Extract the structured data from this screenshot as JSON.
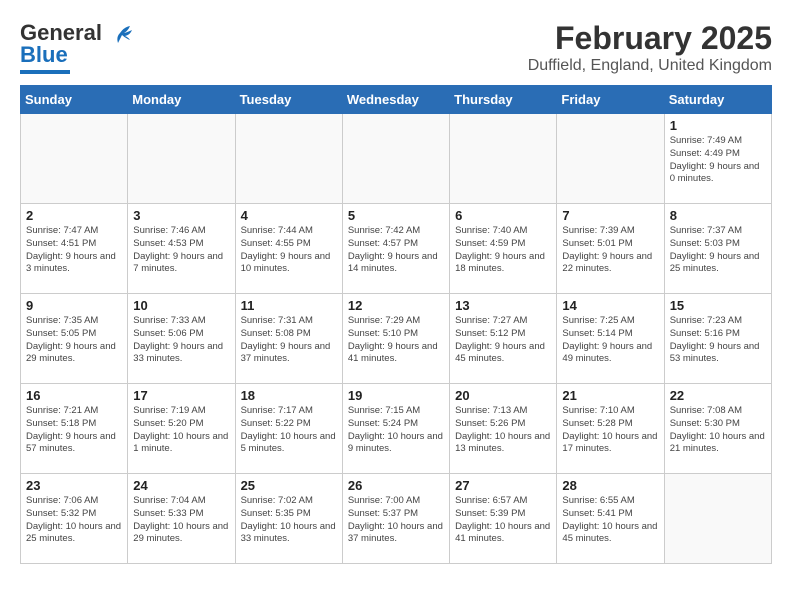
{
  "header": {
    "logo_general": "General",
    "logo_blue": "Blue",
    "title": "February 2025",
    "subtitle": "Duffield, England, United Kingdom"
  },
  "days_of_week": [
    "Sunday",
    "Monday",
    "Tuesday",
    "Wednesday",
    "Thursday",
    "Friday",
    "Saturday"
  ],
  "weeks": [
    [
      {
        "day": "",
        "info": ""
      },
      {
        "day": "",
        "info": ""
      },
      {
        "day": "",
        "info": ""
      },
      {
        "day": "",
        "info": ""
      },
      {
        "day": "",
        "info": ""
      },
      {
        "day": "",
        "info": ""
      },
      {
        "day": "1",
        "info": "Sunrise: 7:49 AM\nSunset: 4:49 PM\nDaylight: 9 hours and 0 minutes."
      }
    ],
    [
      {
        "day": "2",
        "info": "Sunrise: 7:47 AM\nSunset: 4:51 PM\nDaylight: 9 hours and 3 minutes."
      },
      {
        "day": "3",
        "info": "Sunrise: 7:46 AM\nSunset: 4:53 PM\nDaylight: 9 hours and 7 minutes."
      },
      {
        "day": "4",
        "info": "Sunrise: 7:44 AM\nSunset: 4:55 PM\nDaylight: 9 hours and 10 minutes."
      },
      {
        "day": "5",
        "info": "Sunrise: 7:42 AM\nSunset: 4:57 PM\nDaylight: 9 hours and 14 minutes."
      },
      {
        "day": "6",
        "info": "Sunrise: 7:40 AM\nSunset: 4:59 PM\nDaylight: 9 hours and 18 minutes."
      },
      {
        "day": "7",
        "info": "Sunrise: 7:39 AM\nSunset: 5:01 PM\nDaylight: 9 hours and 22 minutes."
      },
      {
        "day": "8",
        "info": "Sunrise: 7:37 AM\nSunset: 5:03 PM\nDaylight: 9 hours and 25 minutes."
      }
    ],
    [
      {
        "day": "9",
        "info": "Sunrise: 7:35 AM\nSunset: 5:05 PM\nDaylight: 9 hours and 29 minutes."
      },
      {
        "day": "10",
        "info": "Sunrise: 7:33 AM\nSunset: 5:06 PM\nDaylight: 9 hours and 33 minutes."
      },
      {
        "day": "11",
        "info": "Sunrise: 7:31 AM\nSunset: 5:08 PM\nDaylight: 9 hours and 37 minutes."
      },
      {
        "day": "12",
        "info": "Sunrise: 7:29 AM\nSunset: 5:10 PM\nDaylight: 9 hours and 41 minutes."
      },
      {
        "day": "13",
        "info": "Sunrise: 7:27 AM\nSunset: 5:12 PM\nDaylight: 9 hours and 45 minutes."
      },
      {
        "day": "14",
        "info": "Sunrise: 7:25 AM\nSunset: 5:14 PM\nDaylight: 9 hours and 49 minutes."
      },
      {
        "day": "15",
        "info": "Sunrise: 7:23 AM\nSunset: 5:16 PM\nDaylight: 9 hours and 53 minutes."
      }
    ],
    [
      {
        "day": "16",
        "info": "Sunrise: 7:21 AM\nSunset: 5:18 PM\nDaylight: 9 hours and 57 minutes."
      },
      {
        "day": "17",
        "info": "Sunrise: 7:19 AM\nSunset: 5:20 PM\nDaylight: 10 hours and 1 minute."
      },
      {
        "day": "18",
        "info": "Sunrise: 7:17 AM\nSunset: 5:22 PM\nDaylight: 10 hours and 5 minutes."
      },
      {
        "day": "19",
        "info": "Sunrise: 7:15 AM\nSunset: 5:24 PM\nDaylight: 10 hours and 9 minutes."
      },
      {
        "day": "20",
        "info": "Sunrise: 7:13 AM\nSunset: 5:26 PM\nDaylight: 10 hours and 13 minutes."
      },
      {
        "day": "21",
        "info": "Sunrise: 7:10 AM\nSunset: 5:28 PM\nDaylight: 10 hours and 17 minutes."
      },
      {
        "day": "22",
        "info": "Sunrise: 7:08 AM\nSunset: 5:30 PM\nDaylight: 10 hours and 21 minutes."
      }
    ],
    [
      {
        "day": "23",
        "info": "Sunrise: 7:06 AM\nSunset: 5:32 PM\nDaylight: 10 hours and 25 minutes."
      },
      {
        "day": "24",
        "info": "Sunrise: 7:04 AM\nSunset: 5:33 PM\nDaylight: 10 hours and 29 minutes."
      },
      {
        "day": "25",
        "info": "Sunrise: 7:02 AM\nSunset: 5:35 PM\nDaylight: 10 hours and 33 minutes."
      },
      {
        "day": "26",
        "info": "Sunrise: 7:00 AM\nSunset: 5:37 PM\nDaylight: 10 hours and 37 minutes."
      },
      {
        "day": "27",
        "info": "Sunrise: 6:57 AM\nSunset: 5:39 PM\nDaylight: 10 hours and 41 minutes."
      },
      {
        "day": "28",
        "info": "Sunrise: 6:55 AM\nSunset: 5:41 PM\nDaylight: 10 hours and 45 minutes."
      },
      {
        "day": "",
        "info": ""
      }
    ]
  ]
}
